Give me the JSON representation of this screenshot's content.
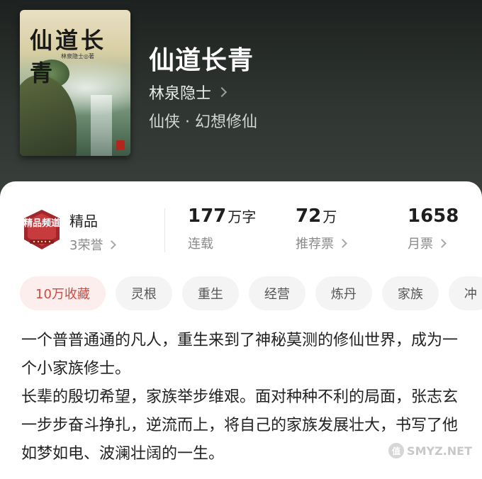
{
  "header": {
    "cover": {
      "title": "仙道长青",
      "author_small": "林泉隐士◎著"
    },
    "title": "仙道长青",
    "author": "林泉隐士",
    "genre": "仙侠 · 幻想修仙"
  },
  "stats": {
    "honor": {
      "title": "精品",
      "sub": "3荣誉",
      "badge_text": "精品频道"
    },
    "words": {
      "num": "177",
      "unit": "万字",
      "label": "连载"
    },
    "recommend": {
      "num": "72",
      "unit": "万",
      "label": "推荐票"
    },
    "monthly": {
      "num": "1658",
      "unit": "",
      "label": "月票"
    }
  },
  "tags": [
    "10万收藏",
    "灵根",
    "重生",
    "经营",
    "炼丹",
    "家族",
    "冲"
  ],
  "description": [
    "一个普普通通的凡人，重生来到了神秘莫测的修仙世界，成为一个小家族修士。",
    "长辈的殷切希望，家族举步维艰。面对种种不利的局面，张志玄一步步奋斗挣扎，逆流而上，将自己的家族发展壮大，书写了他如梦如电、波澜壮阔的一生。"
  ],
  "watermark": "SMYZ.NET",
  "colors": {
    "accent": "#d14a3f",
    "header_bg": "#2f3531"
  }
}
